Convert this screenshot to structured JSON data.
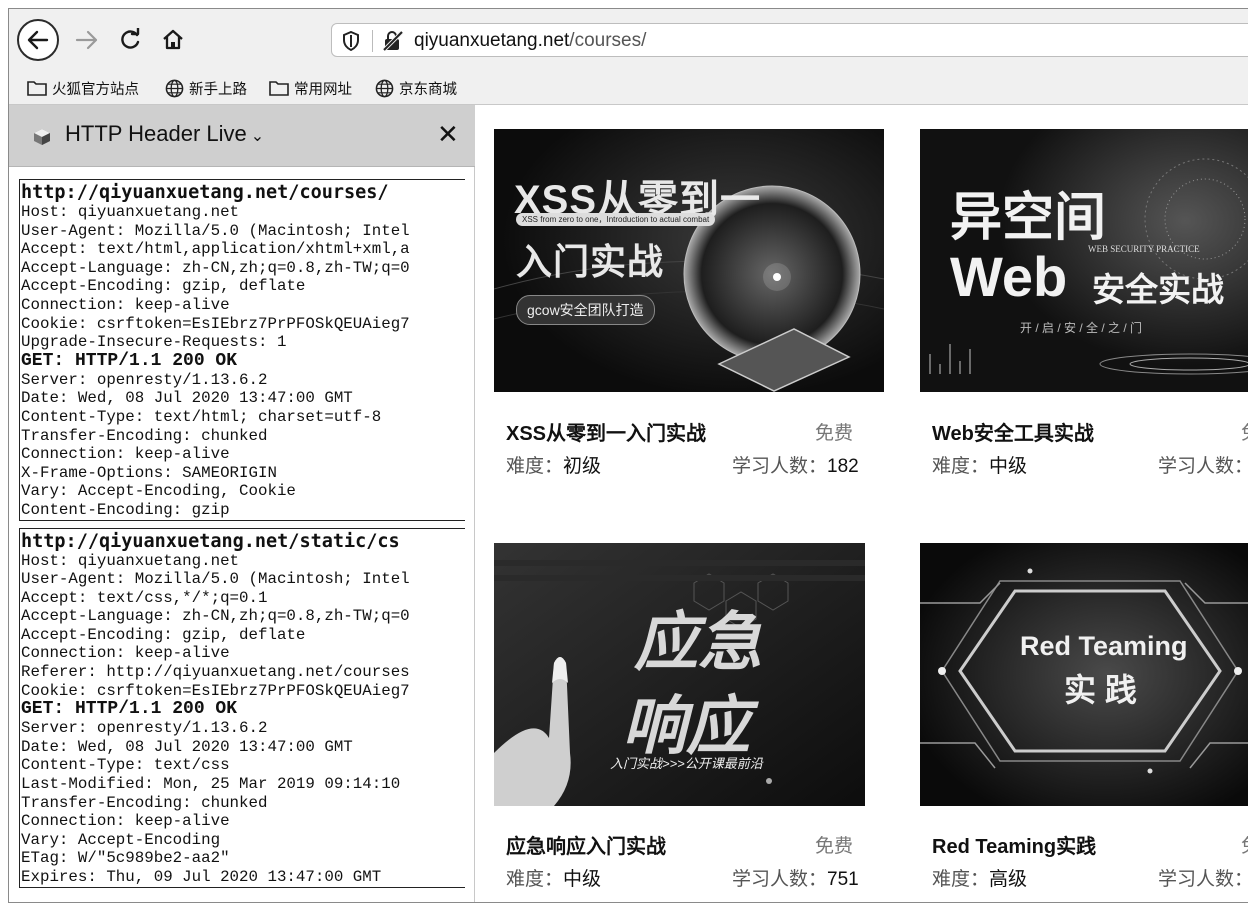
{
  "browser": {
    "url_host": "qiyuanxuetang.net",
    "url_path": "/courses/"
  },
  "bookmarks": [
    {
      "label": "火狐官方站点",
      "icon": "folder-icon"
    },
    {
      "label": "新手上路",
      "icon": "globe-icon"
    },
    {
      "label": "常用网址",
      "icon": "folder-icon"
    },
    {
      "label": "京东商城",
      "icon": "globe-icon"
    }
  ],
  "sidebar": {
    "title": "HTTP Header Live",
    "chevron": "⌄",
    "close": "✕",
    "requests": [
      {
        "url": "http://qiyuanxuetang.net/courses/",
        "request_headers": [
          "Host: qiyuanxuetang.net",
          "User-Agent: Mozilla/5.0 (Macintosh; Intel",
          "Accept: text/html,application/xhtml+xml,a",
          "Accept-Language: zh-CN,zh;q=0.8,zh-TW;q=0",
          "Accept-Encoding: gzip, deflate",
          "Connection: keep-alive",
          "Cookie: csrftoken=EsIEbrz7PrPFOSkQEUAieg7",
          "Upgrade-Insecure-Requests: 1"
        ],
        "status": "GET: HTTP/1.1 200 OK",
        "response_headers": [
          "Server: openresty/1.13.6.2",
          "Date: Wed, 08 Jul 2020 13:47:00 GMT",
          "Content-Type: text/html; charset=utf-8",
          "Transfer-Encoding: chunked",
          "Connection: keep-alive",
          "X-Frame-Options: SAMEORIGIN",
          "Vary: Accept-Encoding, Cookie",
          "Content-Encoding: gzip"
        ]
      },
      {
        "url": "http://qiyuanxuetang.net/static/cs",
        "request_headers": [
          "Host: qiyuanxuetang.net",
          "User-Agent: Mozilla/5.0 (Macintosh; Intel",
          "Accept: text/css,*/*;q=0.1",
          "Accept-Language: zh-CN,zh;q=0.8,zh-TW;q=0",
          "Accept-Encoding: gzip, deflate",
          "Connection: keep-alive",
          "Referer: http://qiyuanxuetang.net/courses",
          "Cookie: csrftoken=EsIEbrz7PrPFOSkQEUAieg7"
        ],
        "status": "GET: HTTP/1.1 200 OK",
        "response_headers": [
          "Server: openresty/1.13.6.2",
          "Date: Wed, 08 Jul 2020 13:47:00 GMT",
          "Content-Type: text/css",
          "Last-Modified: Mon, 25 Mar 2019 09:14:10",
          "Transfer-Encoding: chunked",
          "Connection: keep-alive",
          "Vary: Accept-Encoding",
          "ETag: W/\"5c989be2-aa2\"",
          "Expires: Thu, 09 Jul 2020 13:47:00 GMT"
        ]
      }
    ]
  },
  "courses": [
    {
      "title": "XSS从零到一入门实战",
      "price": "免费",
      "level_label": "难度：",
      "level": "初级",
      "learners_label": "学习人数：",
      "learners": "182",
      "banner": {
        "headline": "XSS从零到一",
        "subline": "XSS from zero to one，Introduction to actual combat",
        "headline2": "入门实战",
        "badge": "gcow安全团队打造"
      }
    },
    {
      "title": "Web安全工具实战",
      "price": "免",
      "level_label": "难度：",
      "level": "中级",
      "learners_label": "学习人数：",
      "learners": "",
      "banner": {
        "headline": "异空间",
        "headline2": "Web",
        "headline3": "安全实战",
        "subline": "WEB SECURITY PRACTICE",
        "tagline": "开 / 启 / 安 / 全 / 之 / 门"
      }
    },
    {
      "title": "应急响应入门实战",
      "price": "免费",
      "level_label": "难度：",
      "level": "中级",
      "learners_label": "学习人数：",
      "learners": "751",
      "banner": {
        "headline": "应急",
        "headline2": "响应",
        "subline": "入门实战>>>公开课最前沿"
      }
    },
    {
      "title": "Red Teaming实践",
      "price": "免",
      "level_label": "难度：",
      "level": "高级",
      "learners_label": "学习人数：",
      "learners": "",
      "banner": {
        "headline": "Red Teaming",
        "headline2": "实 践"
      }
    }
  ]
}
